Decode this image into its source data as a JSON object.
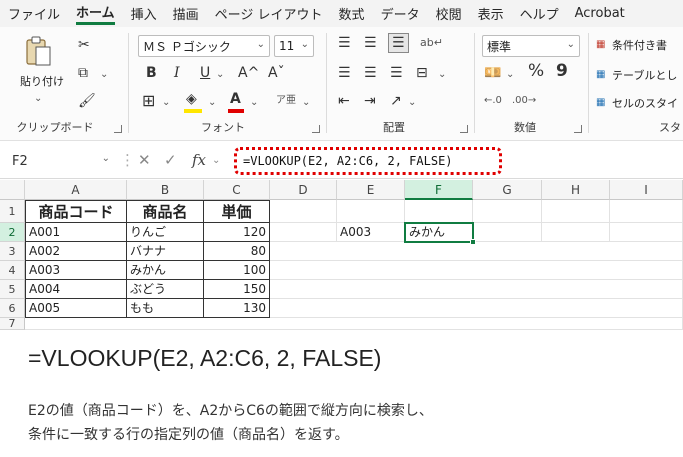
{
  "menu": {
    "tabs": [
      "ファイル",
      "ホーム",
      "挿入",
      "描画",
      "ページ レイアウト",
      "数式",
      "データ",
      "校閲",
      "表示",
      "ヘルプ",
      "Acrobat"
    ],
    "active_tab": "ホーム"
  },
  "ribbon": {
    "clipboard": {
      "paste_label": "貼り付け",
      "group_label": "クリップボード"
    },
    "font": {
      "font_name": "ＭＳ Ｐゴシック",
      "font_size": "11",
      "bold": "B",
      "italic": "I",
      "underline": "U",
      "grow": "A^",
      "shrink": "Aˇ",
      "color_letter": "A",
      "group_label": "フォント"
    },
    "alignment": {
      "group_label": "配置"
    },
    "number": {
      "format": "標準",
      "percent": "%",
      "comma": "9",
      "group_label": "数値"
    },
    "styles": {
      "conditional": "条件付き書",
      "table": "テーブルとし",
      "cell": "セルのスタイ",
      "group_label": "スタ"
    }
  },
  "formula_bar": {
    "name_box": "F2",
    "fx": "fx",
    "formula": "=VLOOKUP(E2, A2:C6, 2, FALSE)"
  },
  "sheet": {
    "columns": [
      "A",
      "B",
      "C",
      "D",
      "E",
      "F",
      "G",
      "H",
      "I"
    ],
    "rows": [
      "1",
      "2",
      "3",
      "4",
      "5",
      "6",
      "7"
    ],
    "header": [
      "商品コード",
      "商品名",
      "単価"
    ],
    "data": [
      [
        "A001",
        "りんご",
        "120"
      ],
      [
        "A002",
        "バナナ",
        "80"
      ],
      [
        "A003",
        "みかん",
        "100"
      ],
      [
        "A004",
        "ぶどう",
        "150"
      ],
      [
        "A005",
        "もも",
        "130"
      ]
    ],
    "e2": "A003",
    "f2": "みかん"
  },
  "caption": {
    "formula": "=VLOOKUP(E2, A2:C6, 2, FALSE)",
    "line1": "E2の値（商品コード）を、A2からC6の範囲で縦方向に検索し、",
    "line2": "条件に一致する行の指定列の値（商品名）を返す。"
  }
}
